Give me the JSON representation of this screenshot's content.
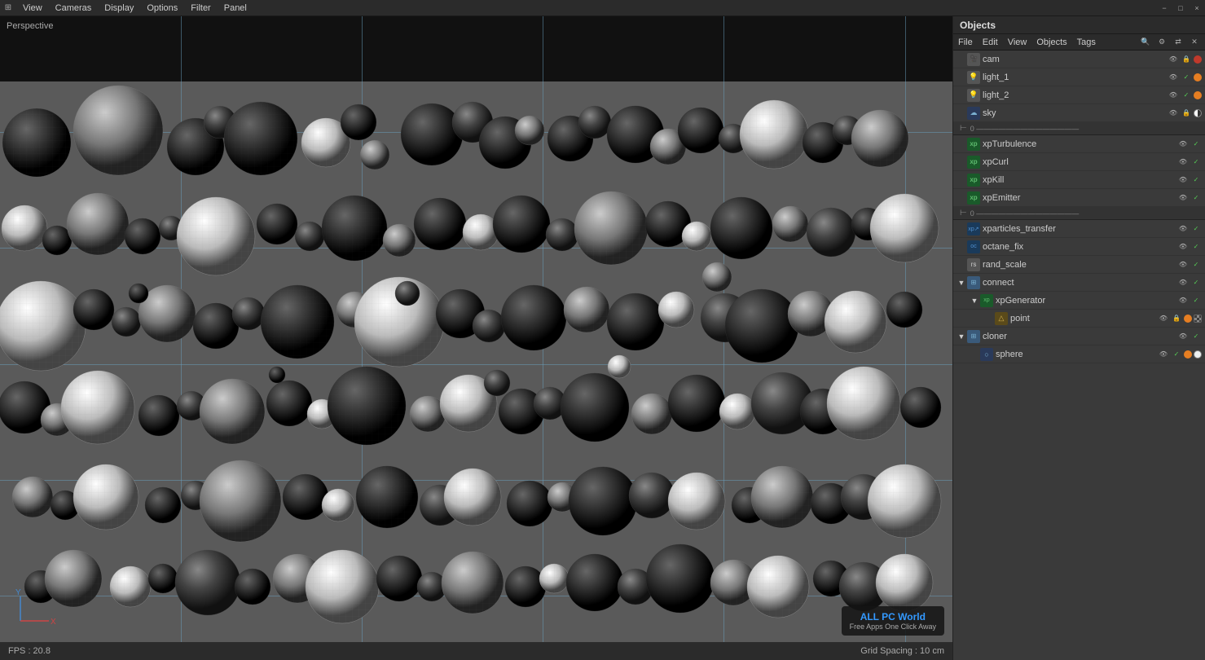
{
  "menubar": {
    "items": [
      "View",
      "Cameras",
      "Display",
      "Options",
      "Filter",
      "Panel"
    ],
    "icon": "≡"
  },
  "viewport": {
    "label": "Perspective",
    "fps": "FPS : 20.8",
    "grid_spacing": "Grid Spacing : 10 cm"
  },
  "objects_panel": {
    "title": "Objects",
    "menu_items": [
      "File",
      "Edit",
      "View",
      "Objects",
      "Tags"
    ],
    "search_icon": "🔍",
    "items": [
      {
        "id": "cam",
        "name": "cam",
        "indent": 0,
        "expand": false,
        "icon": "C",
        "icon_class": "ic-gray",
        "controls": [
          "eye",
          "lock",
          "dot-red"
        ]
      },
      {
        "id": "light_1",
        "name": "light_1",
        "indent": 0,
        "expand": false,
        "icon": "L",
        "icon_class": "ic-white",
        "controls": [
          "eye",
          "check",
          "dot-orange"
        ]
      },
      {
        "id": "light_2",
        "name": "light_2",
        "indent": 0,
        "expand": false,
        "icon": "L",
        "icon_class": "ic-white",
        "controls": [
          "eye",
          "check",
          "dot-orange"
        ]
      },
      {
        "id": "sky",
        "name": "sky",
        "indent": 0,
        "expand": false,
        "icon": "S",
        "icon_class": "ic-blue",
        "controls": [
          "eye",
          "lock",
          "dot-half"
        ]
      },
      {
        "id": "sep1",
        "type": "separator"
      },
      {
        "id": "xpTurbulence",
        "name": "xpTurbulence",
        "indent": 0,
        "expand": false,
        "icon": "T",
        "icon_class": "ic-green",
        "controls": [
          "eye",
          "check"
        ]
      },
      {
        "id": "xpCurl",
        "name": "xpCurl",
        "indent": 0,
        "expand": false,
        "icon": "C",
        "icon_class": "ic-green",
        "controls": [
          "eye",
          "check"
        ]
      },
      {
        "id": "xpKill",
        "name": "xpKill",
        "indent": 0,
        "expand": false,
        "icon": "K",
        "icon_class": "ic-green",
        "controls": [
          "eye",
          "check"
        ]
      },
      {
        "id": "xpEmitter",
        "name": "xpEmitter",
        "indent": 0,
        "expand": false,
        "icon": "E",
        "icon_class": "ic-green",
        "controls": [
          "eye",
          "check"
        ]
      },
      {
        "id": "sep2",
        "type": "separator"
      },
      {
        "id": "xparticles_transfer",
        "name": "xparticles_transfer",
        "indent": 0,
        "expand": false,
        "icon": "X",
        "icon_class": "ic-teal",
        "controls": [
          "eye",
          "check"
        ]
      },
      {
        "id": "octane_fix",
        "name": "octane_fix",
        "indent": 0,
        "expand": false,
        "icon": "O",
        "icon_class": "ic-teal",
        "controls": [
          "eye",
          "check"
        ]
      },
      {
        "id": "rand_scale",
        "name": "rand_scale",
        "indent": 0,
        "expand": false,
        "icon": "R",
        "icon_class": "ic-gray",
        "controls": [
          "eye",
          "check"
        ]
      },
      {
        "id": "connect",
        "name": "connect",
        "indent": 0,
        "expand": true,
        "icon": "C",
        "icon_class": "ic-cube",
        "controls": [
          "eye",
          "check"
        ]
      },
      {
        "id": "xpGenerator",
        "name": "xpGenerator",
        "indent": 1,
        "expand": true,
        "icon": "G",
        "icon_class": "ic-green",
        "controls": [
          "eye",
          "check"
        ]
      },
      {
        "id": "point",
        "name": "point",
        "indent": 2,
        "expand": false,
        "icon": "P",
        "icon_class": "ic-yellow",
        "controls": [
          "eye",
          "lock",
          "dot-orange",
          "checker"
        ]
      },
      {
        "id": "cloner",
        "name": "cloner",
        "indent": 0,
        "expand": true,
        "icon": "C",
        "icon_class": "ic-cube",
        "controls": [
          "eye",
          "check"
        ]
      },
      {
        "id": "sphere",
        "name": "sphere",
        "indent": 1,
        "expand": false,
        "icon": "S",
        "icon_class": "ic-blue",
        "controls": [
          "eye",
          "check",
          "dot-orange",
          "dot-white"
        ]
      }
    ]
  },
  "watermark": {
    "title": "ALL PC World",
    "subtitle": "Free Apps One Click Away"
  },
  "axes": {
    "x_label": "X",
    "y_label": "Y"
  }
}
